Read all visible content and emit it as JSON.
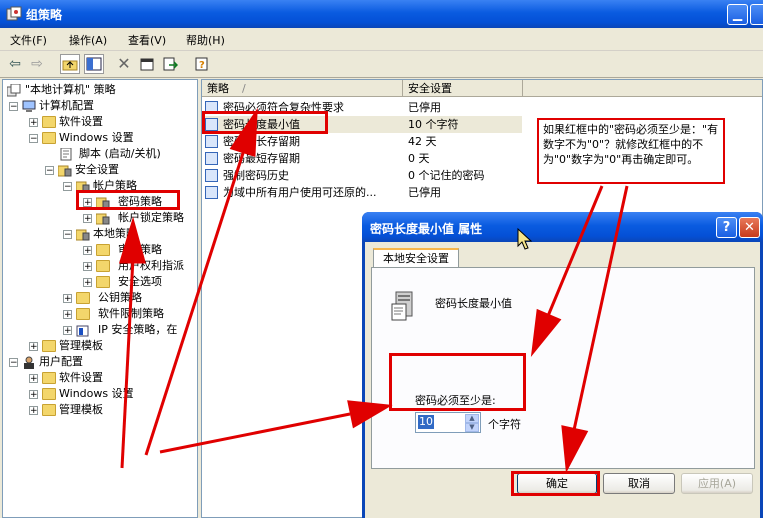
{
  "window": {
    "title": "组策略",
    "icon": "group-policy-icon"
  },
  "menu": [
    "文件(F)",
    "操作(A)",
    "查看(V)",
    "帮助(H)"
  ],
  "toolbar": {
    "icons": [
      "back-arrow-icon",
      "forward-arrow-icon",
      "up-folder-icon",
      "show-tree-icon",
      "delete-icon",
      "properties-icon",
      "export-icon",
      "help-icon"
    ]
  },
  "tree": {
    "root": "\"本地计算机\" 策略",
    "computer_config": "计算机配置",
    "software_settings": "软件设置",
    "windows_settings": "Windows 设置",
    "scripts": "脚本 (启动/关机)",
    "security_settings": "安全设置",
    "account_policies": "帐户策略",
    "password_policy": "密码策略",
    "lockout_policy": "帐户锁定策略",
    "local_policies": "本地策略",
    "audit_policy": "审核策略",
    "user_rights": "用户权利指派",
    "security_options": "安全选项",
    "public_key": "公钥策略",
    "software_restriction": "软件限制策略",
    "ip_security": "IP 安全策略，在",
    "admin_templates": "管理模板",
    "user_config": "用户配置",
    "u_software_settings": "软件设置",
    "u_windows_settings": "Windows 设置",
    "u_admin_templates": "管理模板"
  },
  "list": {
    "col_policy": "策略",
    "col_setting": "安全设置",
    "rows": [
      {
        "policy": "密码必须符合复杂性要求",
        "setting": "已停用"
      },
      {
        "policy": "密码长度最小值",
        "setting": "10 个字符"
      },
      {
        "policy": "密码最长存留期",
        "setting": "42 天"
      },
      {
        "policy": "密码最短存留期",
        "setting": "0 天"
      },
      {
        "policy": "强制密码历史",
        "setting": "0 个记住的密码"
      },
      {
        "policy": "为域中所有用户使用可还原的...",
        "setting": "已停用"
      }
    ]
  },
  "note": "如果红框中的\"密码必须至少是：\"有数字不为\"0\"？就修改红框中的不为\"0\"数字为\"0\"再击确定即可。",
  "dialog": {
    "title": "密码长度最小值 属性",
    "tab": "本地安全设置",
    "heading": "密码长度最小值",
    "field_label": "密码必须至少是:",
    "value": "10",
    "unit": "个字符",
    "ok": "确定",
    "cancel": "取消",
    "apply": "应用(A)",
    "help_btn": "?",
    "close_btn": "✕"
  },
  "colors": {
    "annotation": "#e00000",
    "titlebar": "#0a5be0",
    "selection": "#316ac5"
  }
}
